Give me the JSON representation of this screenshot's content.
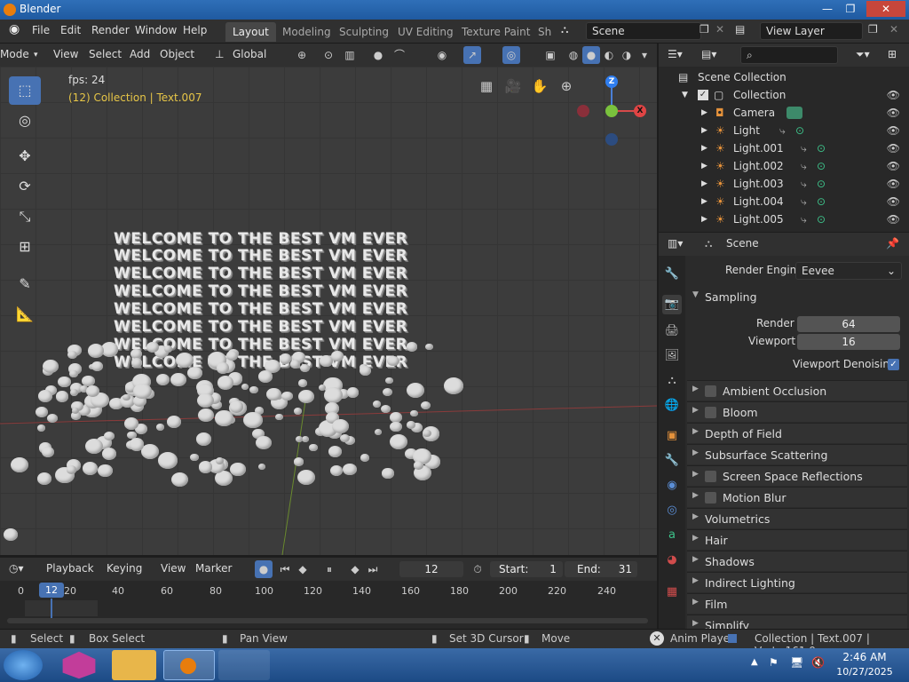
{
  "window": {
    "title": "Blender"
  },
  "menubar": {
    "menus": [
      "File",
      "Edit",
      "Render",
      "Window",
      "Help"
    ],
    "workspaces": [
      "Layout",
      "Modeling",
      "Sculpting",
      "UV Editing",
      "Texture Paint",
      "Sh"
    ],
    "scene": "Scene",
    "view_layer": "View Layer"
  },
  "viewport_header": {
    "mode": "Mode",
    "view": "View",
    "select": "Select",
    "add": "Add",
    "object": "Object",
    "orientation": "Global"
  },
  "viewport": {
    "fps": "fps: 24",
    "collection_info": "(12) Collection | Text.007",
    "text_lines": [
      "WELCOME TO THE BEST VM EVER",
      "WELCOME TO THE BEST VM EVER",
      "WELCOME TO THE BEST VM EVER",
      "WELCOME TO THE BEST VM EVER",
      "WELCOME TO THE BEST VM EVER",
      "WELCOME TO THE BEST VM EVER",
      "WELCOME TO THE BEST VM EVER",
      "WELCOME TO THE BEST VM EVER"
    ],
    "gizmo": {
      "z": "Z",
      "x": "X",
      "y": "Y"
    }
  },
  "timeline": {
    "playback": "Playback",
    "keying": "Keying",
    "view": "View",
    "marker": "Marker",
    "current_frame": "12",
    "start_label": "Start:",
    "start": "1",
    "end_label": "End:",
    "end": "31",
    "ticks": [
      "0",
      "20",
      "40",
      "60",
      "80",
      "100",
      "120",
      "140",
      "160",
      "180",
      "200",
      "220",
      "240"
    ],
    "playhead_label": "12"
  },
  "statusbar": {
    "select": "Select",
    "box_select": "Box Select",
    "pan_view": "Pan View",
    "set_cursor": "Set 3D Cursor",
    "move": "Move",
    "anim_player": "Anim Player",
    "info": "Collection | Text.007 | Verts:161,9"
  },
  "outliner": {
    "root": "Scene Collection",
    "items": [
      {
        "name": "Collection"
      },
      {
        "name": "Camera"
      },
      {
        "name": "Light"
      },
      {
        "name": "Light.001"
      },
      {
        "name": "Light.002"
      },
      {
        "name": "Light.003"
      },
      {
        "name": "Light.004"
      },
      {
        "name": "Light.005"
      }
    ]
  },
  "properties": {
    "context": "Scene",
    "render_engine_label": "Render Engine",
    "render_engine": "Eevee",
    "sampling": "Sampling",
    "render_label": "Render",
    "render_samples": "64",
    "viewport_label": "Viewport",
    "viewport_samples": "16",
    "viewport_denoising": "Viewport Denoising",
    "panels": [
      {
        "label": "Ambient Occlusion",
        "checkbox": true
      },
      {
        "label": "Bloom",
        "checkbox": true
      },
      {
        "label": "Depth of Field",
        "checkbox": false
      },
      {
        "label": "Subsurface Scattering",
        "checkbox": false
      },
      {
        "label": "Screen Space Reflections",
        "checkbox": true
      },
      {
        "label": "Motion Blur",
        "checkbox": true
      },
      {
        "label": "Volumetrics",
        "checkbox": false
      },
      {
        "label": "Hair",
        "checkbox": false
      },
      {
        "label": "Shadows",
        "checkbox": false
      },
      {
        "label": "Indirect Lighting",
        "checkbox": false
      },
      {
        "label": "Film",
        "checkbox": false
      },
      {
        "label": "Simplify",
        "checkbox": false
      }
    ]
  },
  "taskbar": {
    "time": "2:46 AM",
    "date": "10/27/2025"
  },
  "colors": {
    "accent": "#4772b3",
    "highlight_text": "#e6c547",
    "eye": "#cccccc"
  }
}
